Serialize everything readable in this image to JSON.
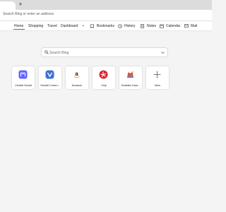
{
  "browser": {
    "new_tab_symbol": "+",
    "address_placeholder": "Search Bing or enter an address"
  },
  "bookmarks_bar": {
    "items": [
      {
        "label": "Home",
        "active": true
      },
      {
        "label": "Shopping"
      },
      {
        "label": "Travel"
      },
      {
        "label": "Dashboard"
      },
      {
        "label": "•"
      },
      {
        "label": "Bookmarks",
        "icon": "bookmark-icon"
      },
      {
        "label": "History",
        "icon": "history-icon"
      },
      {
        "label": "Notes",
        "icon": "notes-icon"
      },
      {
        "label": "Calendar",
        "icon": "calendar-icon"
      },
      {
        "label": "Mail",
        "icon": "mail-icon"
      }
    ]
  },
  "search": {
    "placeholder": "Search Bing"
  },
  "speed_dial": [
    {
      "label": "Vivaldi Social",
      "icon": "mastodon-icon",
      "color": "#6364ff"
    },
    {
      "label": "Vivaldi Comm...",
      "icon": "vivaldi-icon",
      "color": "#3a6fd6"
    },
    {
      "label": "Amazon",
      "icon": "amazon-icon",
      "color": "#ff9900"
    },
    {
      "label": "Yelp",
      "icon": "yelp-icon",
      "color": "#e0202e"
    },
    {
      "label": "Vivaldia Gam...",
      "icon": "vivaldia-game-icon",
      "color": "#e24a42"
    },
    {
      "label": "New",
      "icon": "plus-icon"
    }
  ],
  "colors": {
    "accent": "#1a73e8",
    "page_background": "#f4f4f4"
  }
}
